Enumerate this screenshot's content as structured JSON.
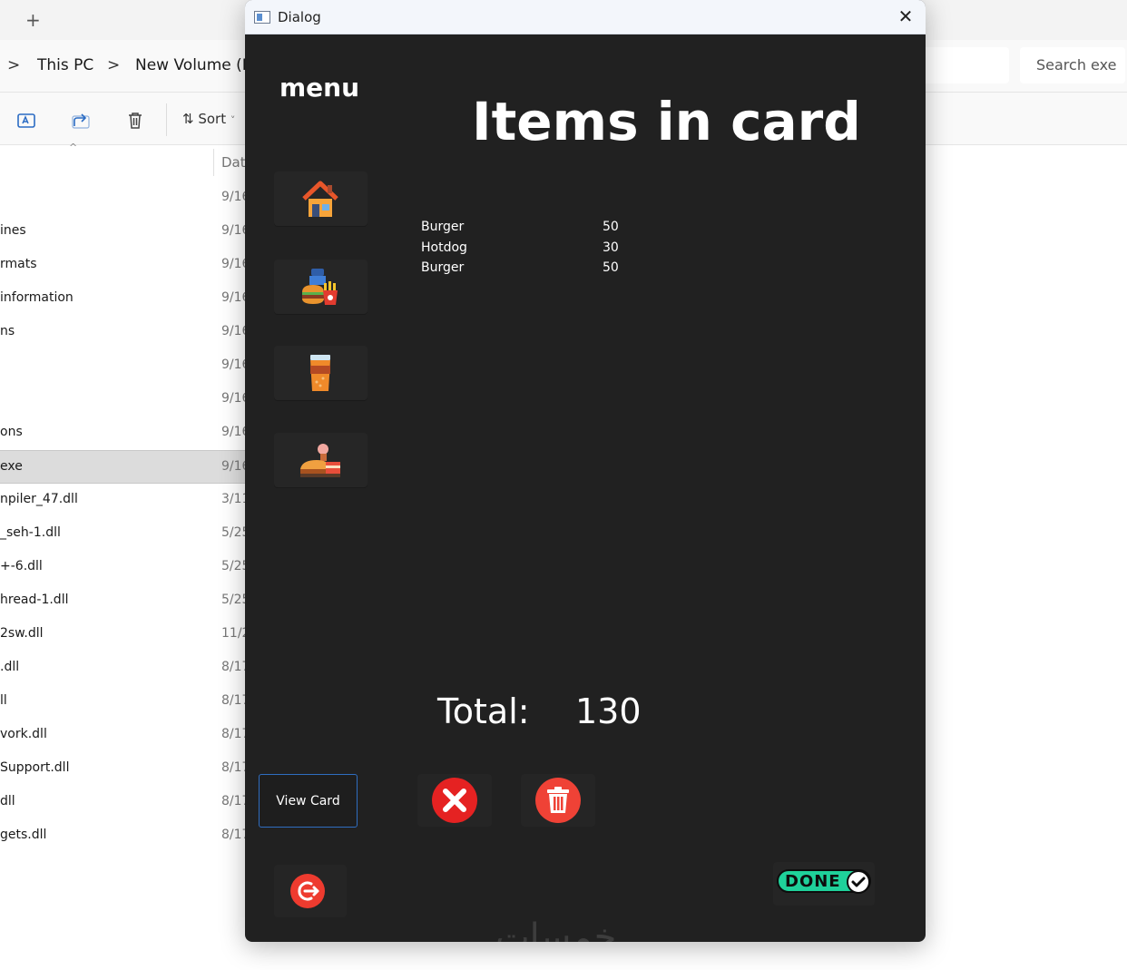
{
  "explorer": {
    "breadcrumbs": [
      "This PC",
      "New Volume (D"
    ],
    "search_placeholder": "Search exe",
    "toolbar": {
      "sort_label": "Sort"
    },
    "column_date": "Date",
    "files": [
      {
        "name": "",
        "date": "9/16"
      },
      {
        "name": "ines",
        "date": "9/16"
      },
      {
        "name": "rmats",
        "date": "9/16"
      },
      {
        "name": "information",
        "date": "9/16"
      },
      {
        "name": "ns",
        "date": "9/16"
      },
      {
        "name": "",
        "date": "9/16"
      },
      {
        "name": "",
        "date": "9/16"
      },
      {
        "name": "ons",
        "date": "9/16"
      },
      {
        "name": "exe",
        "date": "9/16",
        "selected": true
      },
      {
        "name": "npiler_47.dll",
        "date": "3/11"
      },
      {
        "name": "_seh-1.dll",
        "date": "5/25"
      },
      {
        "name": "+-6.dll",
        "date": "5/25"
      },
      {
        "name": "hread-1.dll",
        "date": "5/25"
      },
      {
        "name": "2sw.dll",
        "date": "11/2"
      },
      {
        "name": ".dll",
        "date": "8/17"
      },
      {
        "name": "ll",
        "date": "8/17"
      },
      {
        "name": "vork.dll",
        "date": "8/17"
      },
      {
        "name": "Support.dll",
        "date": "8/17"
      },
      {
        "name": "dll",
        "date": "8/17"
      },
      {
        "name": "gets.dll",
        "date": "8/17"
      }
    ]
  },
  "dialog": {
    "title": "Dialog",
    "menu_label": "menu",
    "heading": "Items in card",
    "sidebar_items": [
      "home-icon",
      "fast-food-icon",
      "drink-icon",
      "dessert-icon"
    ],
    "cart_items": [
      {
        "name": "Burger",
        "price": "50"
      },
      {
        "name": "Hotdog",
        "price": "30"
      },
      {
        "name": "Burger",
        "price": "50"
      }
    ],
    "total_label": "Total:",
    "total_value": "130",
    "view_card_label": "View Card",
    "done_label": "DONE",
    "watermark": "خمسات"
  },
  "colors": {
    "dialog_bg": "#212121",
    "cancel_red": "#e52222",
    "delete_red": "#ef4236",
    "logout_red": "#ee3b2f",
    "done_green": "#1fd19a",
    "view_card_border": "#2f6dc0"
  }
}
